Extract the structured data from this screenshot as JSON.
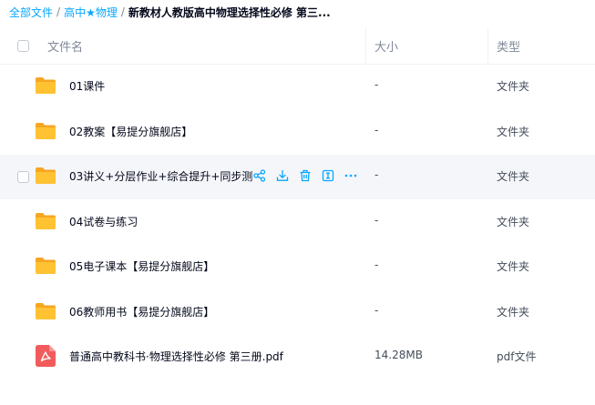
{
  "breadcrumb": {
    "items": [
      "全部文件",
      "高中★物理"
    ],
    "separator": "/",
    "current": "新教材人教版高中物理选择性必修 第三..."
  },
  "table": {
    "headers": {
      "name": "文件名",
      "size": "大小",
      "type": "类型"
    }
  },
  "rows": [
    {
      "icon": "folder-icon",
      "name": "01课件",
      "size": "-",
      "type": "文件夹"
    },
    {
      "icon": "folder-icon",
      "name": "02教案【易提分旗舰店】",
      "size": "-",
      "type": "文件夹"
    },
    {
      "icon": "folder-icon",
      "name": "03讲义+分层作业+综合提升+同步测",
      "size": "-",
      "type": "文件夹",
      "hovered": true
    },
    {
      "icon": "folder-icon",
      "name": "04试卷与练习",
      "size": "-",
      "type": "文件夹"
    },
    {
      "icon": "folder-icon",
      "name": "05电子课本【易提分旗舰店】",
      "size": "-",
      "type": "文件夹"
    },
    {
      "icon": "folder-icon",
      "name": "06教师用书【易提分旗舰店】",
      "size": "-",
      "type": "文件夹"
    },
    {
      "icon": "pdf-icon",
      "name": "普通高中教科书·物理选择性必修 第三册.pdf",
      "size": "14.28MB",
      "type": "pdf文件"
    }
  ],
  "hover_actions": [
    "share-icon",
    "download-icon",
    "delete-icon",
    "rename-icon",
    "more-icon"
  ],
  "colors": {
    "accent": "#06a7ff",
    "folder": "#ffc233",
    "folder_tab": "#f5a623",
    "pdf": "#f25b5b",
    "hover_bg": "#f5f6fa"
  }
}
